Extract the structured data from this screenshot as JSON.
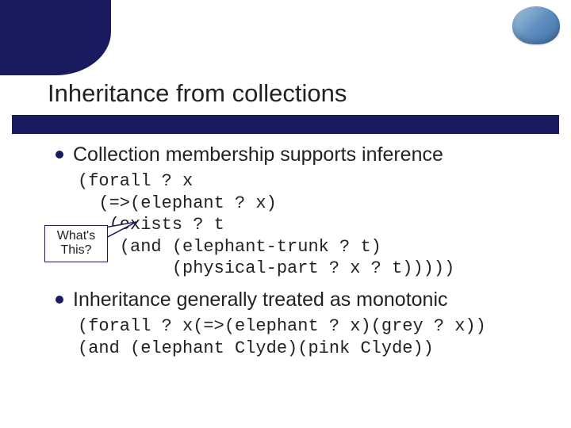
{
  "title": "Inheritance from collections",
  "bullets": [
    {
      "text": "Collection membership supports inference",
      "code": "(forall ? x\n  (=>(elephant ? x)\n   (exists ? t\n    (and (elephant-trunk ? t)\n         (physical-part ? x ? t)))))"
    },
    {
      "text": "Inheritance generally treated as monotonic",
      "code": "(forall ? x(=>(elephant ? x)(grey ? x))\n(and (elephant Clyde)(pink Clyde))"
    }
  ],
  "callout": {
    "line1": "What's",
    "line2": "This?"
  }
}
